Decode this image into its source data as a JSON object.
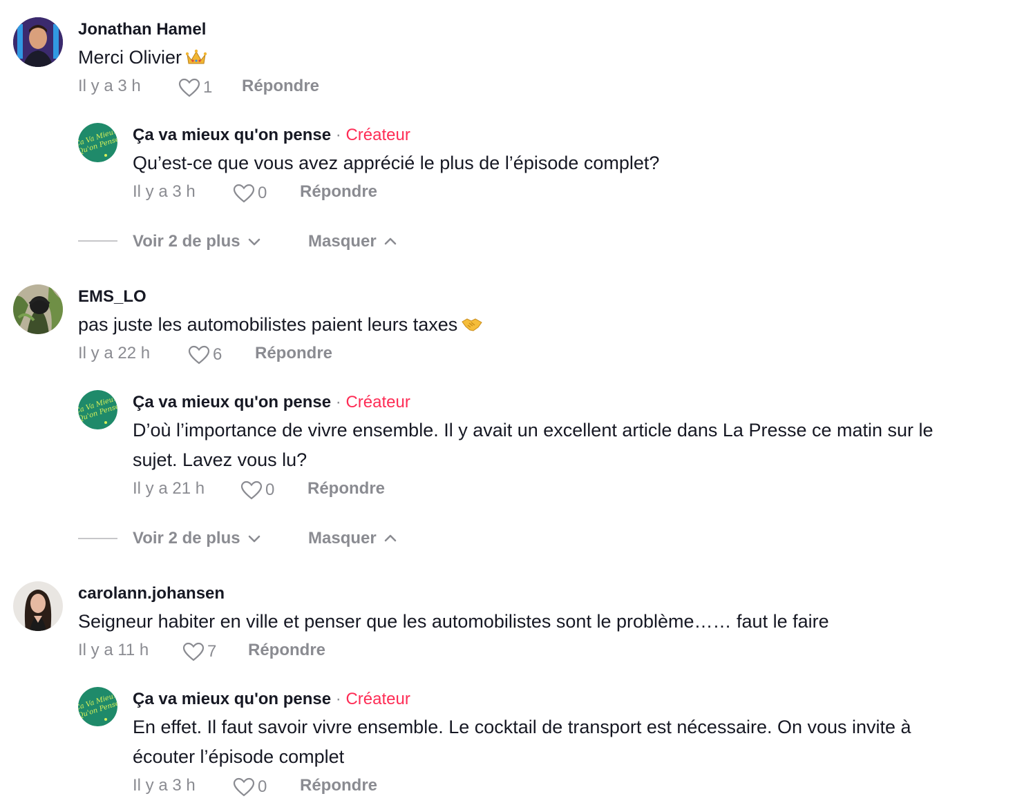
{
  "comments": [
    {
      "username": "Jonathan Hamel",
      "text": "Merci Olivier",
      "emoji_icon": "crown-icon",
      "time": "Il y a 3 h",
      "likes": "1",
      "reply_label": "Répondre",
      "reply": {
        "username": "Ça va mieux qu'on pense",
        "dot": "·",
        "creator_label": "Créateur",
        "text": "Qu’est-ce que vous avez apprécié le plus de l’épisode complet?",
        "time": "Il y a 3 h",
        "likes": "0",
        "reply_label": "Répondre"
      },
      "view_more": "Voir 2 de plus",
      "hide": "Masquer"
    },
    {
      "username": "EMS_LO",
      "text": "pas juste les automobilistes paient leurs taxes",
      "emoji_icon": "handshake-icon",
      "time": "Il y a 22 h",
      "likes": "6",
      "reply_label": "Répondre",
      "reply": {
        "username": "Ça va mieux qu'on pense",
        "dot": "·",
        "creator_label": "Créateur",
        "text_line1": "D’où l’importance de vivre ensemble. Il y avait un excellent article dans La Presse ce matin sur le",
        "text_line2": "sujet. Lavez vous lu?",
        "time": "Il y a 21 h",
        "likes": "0",
        "reply_label": "Répondre"
      },
      "view_more": "Voir 2 de plus",
      "hide": "Masquer"
    },
    {
      "username": "carolann.johansen",
      "text": "Seigneur habiter en ville et penser que les automobilistes sont le problème…… faut le faire",
      "time": "Il y a 11 h",
      "likes": "7",
      "reply_label": "Répondre",
      "reply": {
        "username": "Ça va mieux qu'on pense",
        "dot": "·",
        "creator_label": "Créateur",
        "text_line1": "En effet. Il faut savoir vivre ensemble. Le cocktail de transport est nécessaire. On vous invite à",
        "text_line2": "écouter l’épisode complet",
        "time": "Il y a 3 h",
        "likes": "0",
        "reply_label": "Répondre"
      }
    }
  ],
  "colors": {
    "creator": "#fe2c55",
    "muted": "#8a8b91",
    "brand_green": "#1f8a6a",
    "logo_text": "#d8f05a"
  }
}
